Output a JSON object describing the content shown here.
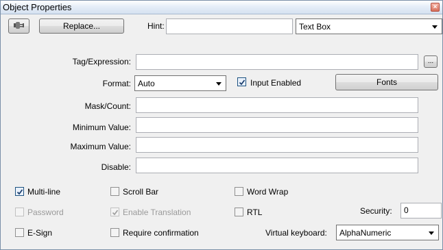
{
  "window": {
    "title": "Object Properties"
  },
  "row1": {
    "replace_label": "Replace...",
    "hint_label": "Hint:",
    "hint_value": "",
    "object_type": "Text Box"
  },
  "form": {
    "tag_label": "Tag/Expression:",
    "tag_value": "",
    "ellipsis_label": "...",
    "format_label": "Format:",
    "format_value": "Auto",
    "input_enabled_label": "Input Enabled",
    "fonts_label": "Fonts",
    "mask_label": "Mask/Count:",
    "min_label": "Minimum Value:",
    "max_label": "Maximum Value:",
    "disable_label": "Disable:"
  },
  "options": {
    "multiline": "Multi-line",
    "scrollbar": "Scroll Bar",
    "wordwrap": "Word Wrap",
    "password": "Password",
    "enable_translation": "Enable Translation",
    "rtl": "RTL",
    "security_label": "Security:",
    "security_value": "0",
    "esign": "E-Sign",
    "require_confirmation": "Require confirmation",
    "vk_label": "Virtual keyboard:",
    "vk_value": "AlphaNumeric"
  },
  "states": {
    "input_enabled": true,
    "multiline": true,
    "scrollbar": false,
    "wordwrap": false,
    "password": false,
    "password_disabled": true,
    "enable_translation": true,
    "enable_translation_disabled": true,
    "rtl": false,
    "esign": false,
    "require_confirmation": false
  },
  "icons": {
    "close": "close-icon",
    "replace": "plug-icon",
    "dropdown": "chevron-down-icon",
    "check": "checkmark-icon"
  },
  "colors": {
    "title_gradient_start": "#ffffff",
    "title_gradient_end": "#d5e1f0",
    "close_red": "#d7705b",
    "disabled_text": "#9a9a9a"
  }
}
